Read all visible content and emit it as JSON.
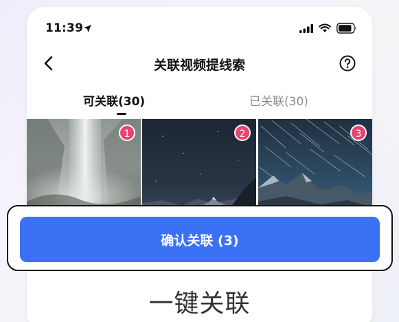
{
  "status_bar": {
    "time": "11:39",
    "icons": [
      "location-arrow-icon",
      "signal-icon",
      "wifi-icon",
      "battery-icon"
    ]
  },
  "nav": {
    "title": "关联视频提线索",
    "back_icon": "chevron-left-icon",
    "help_icon": "question-circle-icon"
  },
  "tabs": [
    {
      "label": "可关联(30)",
      "active": true
    },
    {
      "label": "已关联(30)",
      "active": false
    }
  ],
  "thumbnails": [
    {
      "badge": "1",
      "subject": "waterfall"
    },
    {
      "badge": "2",
      "subject": "night-sky-mountain"
    },
    {
      "badge": "3",
      "subject": "star-trails-mountain"
    }
  ],
  "confirm_button": {
    "label": "确认关联 (3)"
  },
  "caption": "一键关联",
  "colors": {
    "accent": "#3b72f5",
    "badge": "#e94470",
    "text_primary": "#111111",
    "text_secondary": "#8a8a92"
  }
}
